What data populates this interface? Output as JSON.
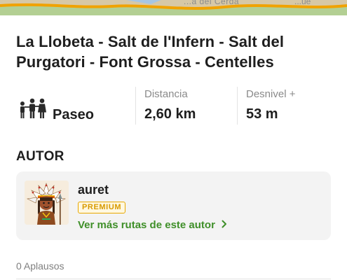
{
  "map": {
    "label_partial": "...a del Cerdà",
    "label_partial2": "...ue"
  },
  "route": {
    "title_line1": "La Llobeta - Salt de l'Infern - Salt del",
    "title_line2": "Purgatori - Font Grossa - Centelles"
  },
  "stats": {
    "activity_icon": "family-walk-icon",
    "activity": "Paseo",
    "distance_label": "Distancia",
    "distance_value": "2,60 km",
    "elevation_label": "Desnivel +",
    "elevation_value": "53 m"
  },
  "author_section": {
    "title": "AUTOR",
    "name": "auret",
    "badge": "PREMIUM",
    "link_label": "Ver más rutas de este autor",
    "link_icon": "chevron-right-icon",
    "avatar_icon": "chief-avatar-icon"
  },
  "footer": {
    "applause": "0 Aplausos"
  },
  "colors": {
    "accent_green": "#3f8f29",
    "premium_gold": "#e8a800",
    "card_bg": "#f3f3f3"
  }
}
